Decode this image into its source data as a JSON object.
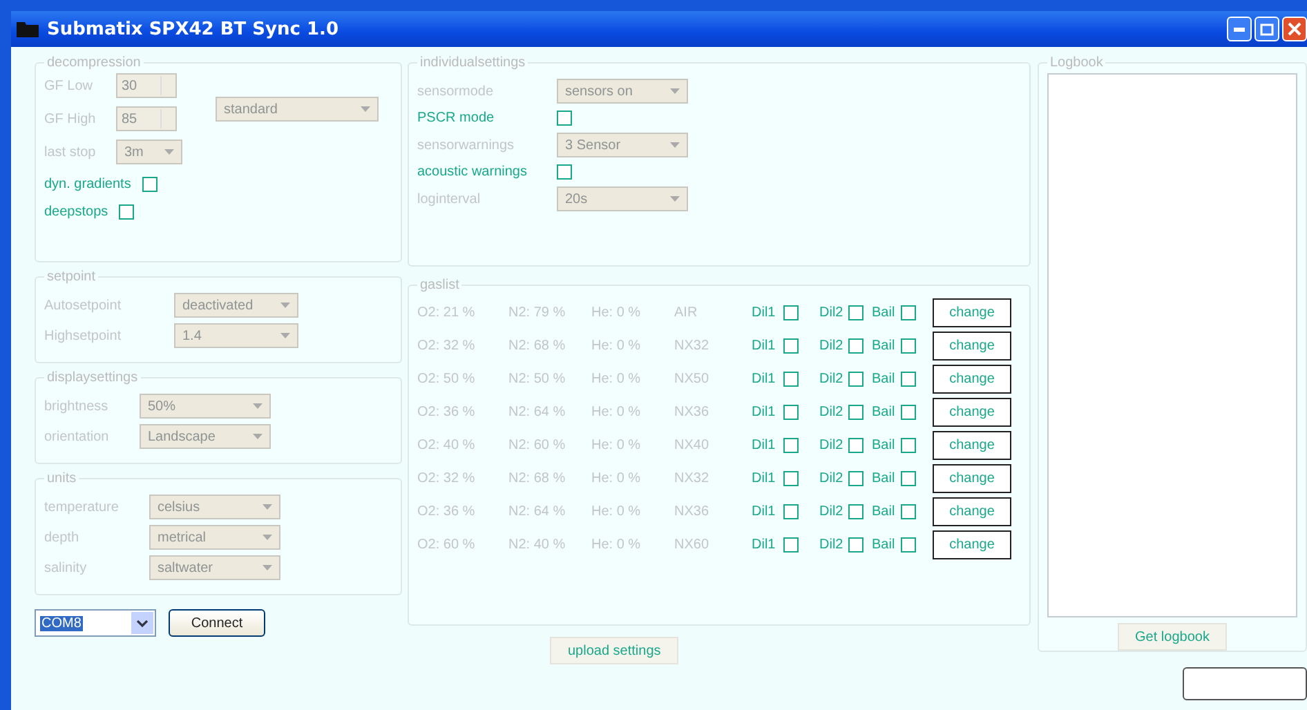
{
  "window": {
    "title": "Submatix SPX42 BT Sync 1.0"
  },
  "decompression": {
    "legend": "decompression",
    "fields": [
      {
        "label": "GF Low",
        "value": "30",
        "kind": "spinner",
        "disabled": true
      },
      {
        "label": "GF High",
        "value": "85",
        "kind": "spinner",
        "disabled": true
      },
      {
        "label": "last stop",
        "value": "3m",
        "kind": "select",
        "disabled": true
      }
    ],
    "preset": {
      "value": "standard",
      "disabled": true
    },
    "checks": [
      {
        "label": "dyn. gradients",
        "checked": false
      },
      {
        "label": "deepstops",
        "checked": false
      }
    ]
  },
  "groups": [
    {
      "legend": "setpoint",
      "rows": [
        {
          "label": "Autosetpoint",
          "value": "deactivated",
          "disabled": true
        },
        {
          "label": "Highsetpoint",
          "value": "1.4",
          "disabled": true
        }
      ]
    },
    {
      "legend": "displaysettings",
      "rows": [
        {
          "label": "brightness",
          "value": "50%",
          "disabled": true
        },
        {
          "label": "orientation",
          "value": "Landscape",
          "disabled": true
        }
      ]
    },
    {
      "legend": "units",
      "rows": [
        {
          "label": "temperature",
          "value": "celsius",
          "disabled": true
        },
        {
          "label": "depth",
          "value": "metrical",
          "disabled": true
        },
        {
          "label": "salinity",
          "value": "saltwater",
          "disabled": true
        }
      ]
    }
  ],
  "connection": {
    "port": "COM8",
    "button": "Connect"
  },
  "individual": {
    "legend": "individualsettings",
    "rows": [
      {
        "kind": "select",
        "label": "sensormode",
        "value": "sensors on",
        "disabled": true
      },
      {
        "kind": "check",
        "label": "PSCR mode",
        "checked": false
      },
      {
        "kind": "select",
        "label": "sensorwarnings",
        "value": "3 Sensor",
        "disabled": true
      },
      {
        "kind": "check",
        "label": "acoustic warnings",
        "checked": false
      },
      {
        "kind": "select",
        "label": "loginterval",
        "value": "20s",
        "disabled": true
      }
    ]
  },
  "gaslist": {
    "legend": "gaslist",
    "rows": [
      {
        "o2": "O2: 21 %",
        "n2": "N2: 79 %",
        "he": "He: 0 %",
        "name": "AIR",
        "checks": [
          {
            "label": "Dil1",
            "checked": false
          },
          {
            "label": "Dil2",
            "checked": false
          },
          {
            "label": "Bail",
            "checked": false
          }
        ],
        "button": "change"
      },
      {
        "o2": "O2: 32 %",
        "n2": "N2: 68 %",
        "he": "He: 0 %",
        "name": "NX32",
        "checks": [
          {
            "label": "Dil1",
            "checked": false
          },
          {
            "label": "Dil2",
            "checked": false
          },
          {
            "label": "Bail",
            "checked": false
          }
        ],
        "button": "change"
      },
      {
        "o2": "O2: 50 %",
        "n2": "N2: 50 %",
        "he": "He: 0 %",
        "name": "NX50",
        "checks": [
          {
            "label": "Dil1",
            "checked": false
          },
          {
            "label": "Dil2",
            "checked": false
          },
          {
            "label": "Bail",
            "checked": false
          }
        ],
        "button": "change"
      },
      {
        "o2": "O2: 36 %",
        "n2": "N2: 64 %",
        "he": "He: 0 %",
        "name": "NX36",
        "checks": [
          {
            "label": "Dil1",
            "checked": false
          },
          {
            "label": "Dil2",
            "checked": false
          },
          {
            "label": "Bail",
            "checked": false
          }
        ],
        "button": "change"
      },
      {
        "o2": "O2: 40 %",
        "n2": "N2: 60 %",
        "he": "He: 0 %",
        "name": "NX40",
        "checks": [
          {
            "label": "Dil1",
            "checked": false
          },
          {
            "label": "Dil2",
            "checked": false
          },
          {
            "label": "Bail",
            "checked": false
          }
        ],
        "button": "change"
      },
      {
        "o2": "O2: 32 %",
        "n2": "N2: 68 %",
        "he": "He: 0 %",
        "name": "NX32",
        "checks": [
          {
            "label": "Dil1",
            "checked": false
          },
          {
            "label": "Dil2",
            "checked": false
          },
          {
            "label": "Bail",
            "checked": false
          }
        ],
        "button": "change"
      },
      {
        "o2": "O2: 36 %",
        "n2": "N2: 64 %",
        "he": "He: 0 %",
        "name": "NX36",
        "checks": [
          {
            "label": "Dil1",
            "checked": false
          },
          {
            "label": "Dil2",
            "checked": false
          },
          {
            "label": "Bail",
            "checked": false
          }
        ],
        "button": "change"
      },
      {
        "o2": "O2: 60 %",
        "n2": "N2: 40 %",
        "he": "He: 0 %",
        "name": "NX60",
        "checks": [
          {
            "label": "Dil1",
            "checked": false
          },
          {
            "label": "Dil2",
            "checked": false
          },
          {
            "label": "Bail",
            "checked": false
          }
        ],
        "button": "change"
      }
    ]
  },
  "upload_button": "upload settings",
  "logbook": {
    "legend": "Logbook",
    "button": "Get logbook"
  }
}
